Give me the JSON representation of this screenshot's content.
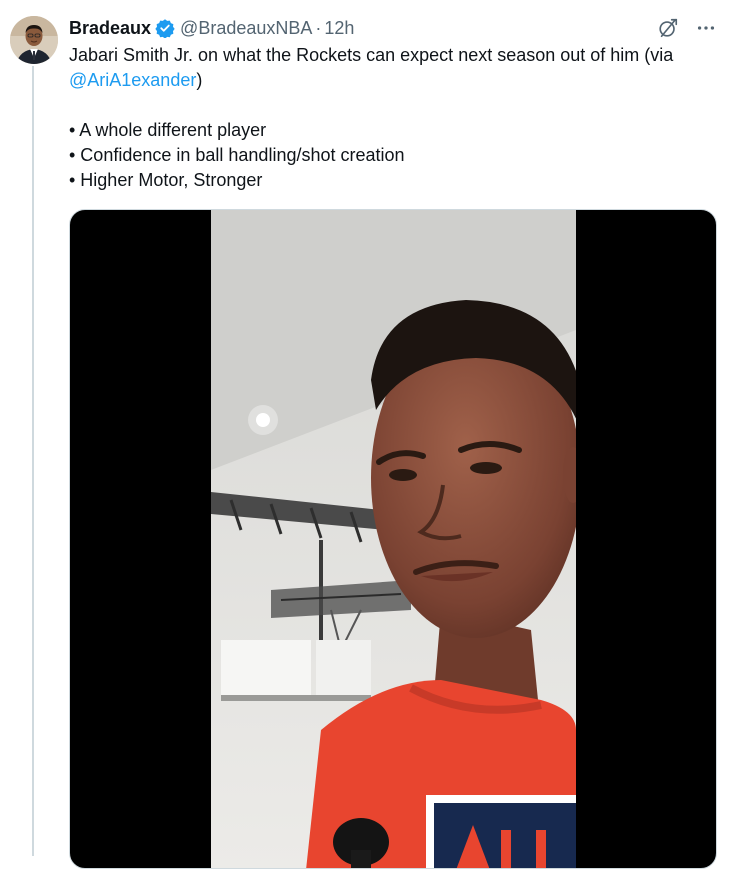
{
  "tweet": {
    "author_name": "Bradeaux",
    "author_handle": "@BradeauxNBA",
    "separator": "·",
    "timestamp": "12h",
    "text_line_1": "Jabari Smith Jr. on what the Rockets can expect next season out of him (via",
    "mention": "@AriA1exander",
    "mention_close": ")",
    "bullets": [
      "• A whole different player",
      "• Confidence in ball handling/shot creation",
      "• Higher Motor, Stronger"
    ]
  },
  "icons": {
    "verified": "verified-badge-icon",
    "grok": "grok-icon",
    "more": "more-icon"
  },
  "colors": {
    "accent": "#1d9bf0",
    "text": "#0f1419",
    "secondary": "#536471",
    "jersey": "#e8452f"
  }
}
